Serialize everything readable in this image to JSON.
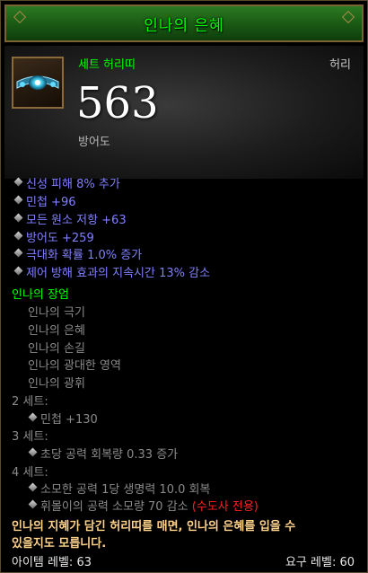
{
  "header": {
    "item_name": "인나의 은혜"
  },
  "item": {
    "icon": "belt-icon",
    "set_label": "세트 허리띠",
    "slot": "허리",
    "armor_value": "563",
    "armor_label": "방어도"
  },
  "stats": [
    "신성 피해 8% 추가",
    "민첩 +96",
    "모든 원소 저항 +63",
    "방어도 +259",
    "극대화 확률 1.0% 증가",
    "제어 방해 효과의 지속시간 13% 감소"
  ],
  "set": {
    "name": "인나의 장엄",
    "pieces": [
      "인나의 극기",
      "인나의 은혜",
      "인나의 손길",
      "인나의 광대한 영역",
      "인나의 광휘"
    ],
    "bonus2_label": "2 세트:",
    "bonus2": "민첩 +130",
    "bonus3_label": "3 세트:",
    "bonus3": "초당 공력 회복량 0.33 증가",
    "bonus4_label": "4 세트:",
    "bonus4_a": "소모한 공력 1당 생명력 10.0 회복",
    "bonus4_b": "휘몰이의 공력 소모량 70 감소",
    "bonus4_b_class": "(수도사 전용)"
  },
  "flavor": {
    "line1": "인나의 지혜가 담긴 허리띠를 매면, 인나의 은혜를 입을 수",
    "line2": "있을지도 모릅니다."
  },
  "footer": {
    "item_level": "아이템 레벨: 63",
    "required_level": "요구 레벨: 60"
  },
  "colors": {
    "set_green": "#00ff00",
    "magic_blue": "#8080ff",
    "inactive_gray": "#8a8a8a",
    "class_red": "#ff2020",
    "flavor_gold": "#ffd28a"
  }
}
